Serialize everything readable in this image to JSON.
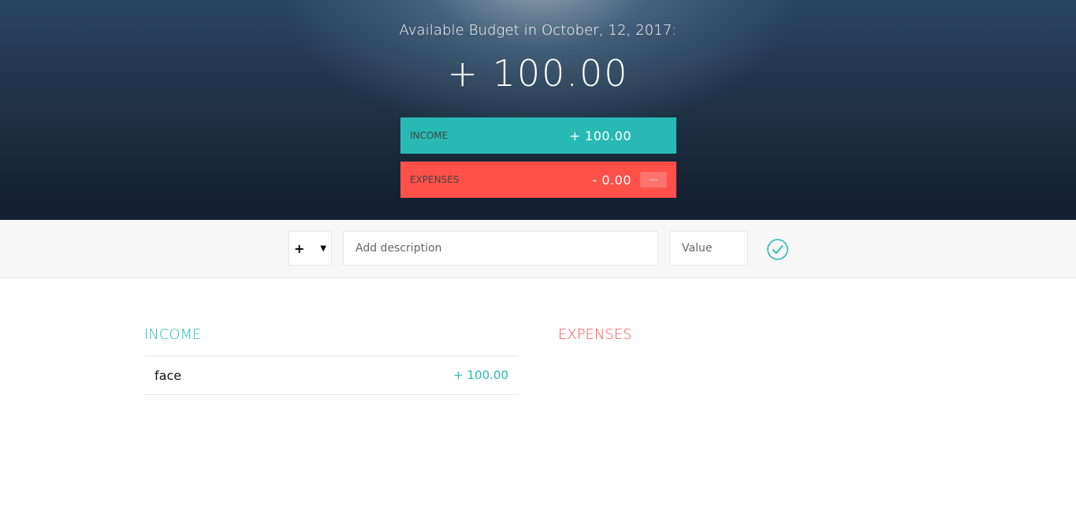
{
  "header": {
    "title": "Available Budget in October, 12, 2017:",
    "budget_value": "+ 100.00"
  },
  "summary": {
    "income": {
      "label": "Income",
      "value": "+ 100.00"
    },
    "expenses": {
      "label": "Expenses",
      "value": "- 0.00",
      "percentage": "---"
    }
  },
  "add_form": {
    "type_value": "+",
    "type_options": [
      "+",
      "-"
    ],
    "description_placeholder": "Add description",
    "value_placeholder": "Value"
  },
  "income": {
    "title": "Income",
    "items": [
      {
        "description": "face",
        "value": "+ 100.00"
      }
    ]
  },
  "expenses": {
    "title": "Expenses",
    "items": []
  },
  "colors": {
    "income": "#28b9b5",
    "expenses": "#ff5049",
    "accent": "#28b9b5"
  },
  "icons": {
    "add": "checkmark-circle-icon",
    "select": "chevron-down-icon"
  }
}
